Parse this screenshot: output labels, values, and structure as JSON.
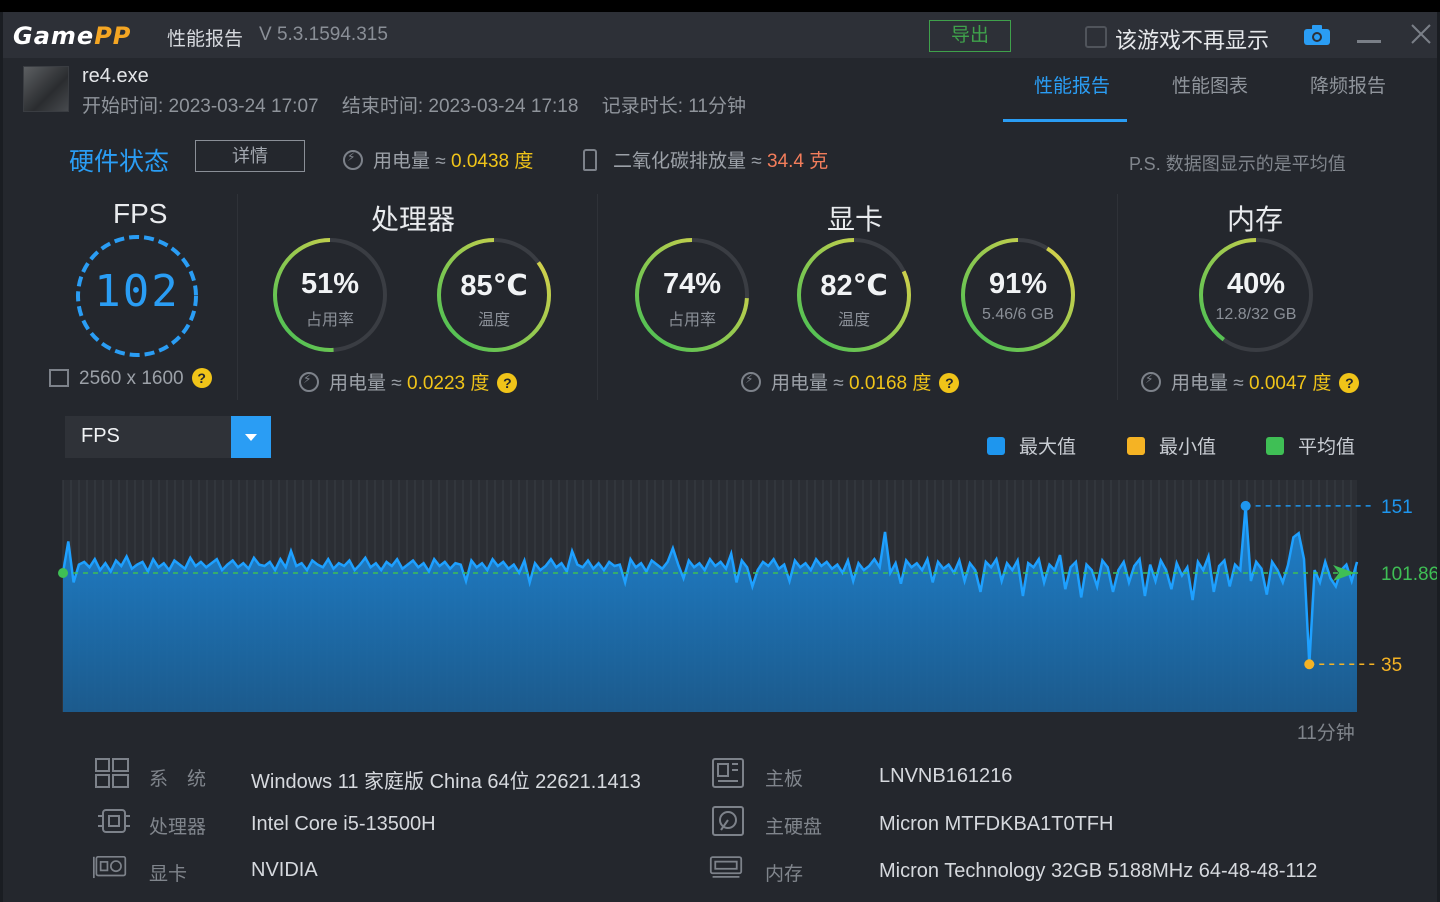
{
  "titlebar": {
    "logo_main": "Game",
    "logo_accent": "PP",
    "title": "性能报告",
    "version": "V 5.3.1594.315",
    "export_label": "导出",
    "hide_label": "该游戏不再显示",
    "icons": [
      "camera-icon",
      "minimize-icon",
      "close-icon"
    ]
  },
  "session": {
    "exe": "re4.exe",
    "start": "开始时间: 2023-03-24 17:07",
    "end": "结束时间: 2023-03-24 17:18",
    "duration": "记录时长: 11分钟"
  },
  "tabs": [
    {
      "label": "性能报告",
      "active": true
    },
    {
      "label": "性能图表",
      "active": false
    },
    {
      "label": "降频报告",
      "active": false
    }
  ],
  "hardware": {
    "title": "硬件状态",
    "detail_label": "详情",
    "power_label": "用电量 ≈ ",
    "power_value": "0.0438 度",
    "co2_label": "二氧化碳排放量 ≈ ",
    "co2_value": "34.4 克",
    "note": "P.S. 数据图显示的是平均值"
  },
  "sections": {
    "fps": {
      "head": "FPS",
      "value": "102",
      "resolution": "2560 x 1600"
    },
    "cpu": {
      "head": "处理器",
      "usage": "51%",
      "usage_label": "占用率",
      "usage_fraction": 0.51,
      "temp": "85℃",
      "temp_label": "温度",
      "temp_fraction": 0.85,
      "power_label": "用电量 ≈ ",
      "power_value": "0.0223 度"
    },
    "gpu": {
      "head": "显卡",
      "usage": "74%",
      "usage_label": "占用率",
      "usage_fraction": 0.74,
      "temp": "82℃",
      "temp_label": "温度",
      "temp_fraction": 0.82,
      "vram": "91%",
      "vram_label": "5.46/6 GB",
      "vram_fraction": 0.91,
      "power_label": "用电量 ≈ ",
      "power_value": "0.0168 度"
    },
    "memory": {
      "head": "内存",
      "usage": "40%",
      "usage_label": "12.8/32 GB",
      "usage_fraction": 0.4,
      "power_label": "用电量 ≈ ",
      "power_value": "0.0047 度"
    }
  },
  "metric_select": {
    "value": "FPS"
  },
  "legend": [
    {
      "label": "最大值",
      "color": "#1e96ee"
    },
    {
      "label": "最小值",
      "color": "#f5b324"
    },
    {
      "label": "平均值",
      "color": "#3fbf55"
    }
  ],
  "chart_data": {
    "type": "area",
    "title": "",
    "xlabel": "",
    "ylabel": "",
    "x_end_label": "11分钟",
    "ylim": [
      0,
      170
    ],
    "max": 151,
    "min": 35,
    "avg": 101.86,
    "max_label": "151",
    "min_label": "35",
    "avg_label": "101.86",
    "series": [
      {
        "values": [
          102,
          125,
          95,
          108,
          110,
          106,
          112,
          104,
          109,
          103,
          111,
          107,
          114,
          105,
          108,
          110,
          103,
          112,
          106,
          109,
          104,
          111,
          108,
          105,
          113,
          107,
          110,
          106,
          109,
          112,
          104,
          108,
          111,
          106,
          109,
          105,
          113,
          108,
          107,
          110,
          104,
          112,
          106,
          118,
          107,
          109,
          104,
          111,
          108,
          106,
          112,
          105,
          109,
          107,
          111,
          104,
          108,
          113,
          106,
          109,
          104,
          110,
          107,
          112,
          105,
          108,
          111,
          106,
          109,
          103,
          112,
          107,
          110,
          105,
          109,
          108,
          96,
          111,
          106,
          109,
          104,
          112,
          107,
          110,
          105,
          108,
          102,
          111,
          95,
          109,
          104,
          107,
          112,
          106,
          109,
          103,
          118,
          108,
          106,
          111,
          105,
          109,
          104,
          110,
          107,
          108,
          95,
          112,
          106,
          109,
          103,
          111,
          108,
          105,
          110,
          120,
          108,
          98,
          111,
          106,
          109,
          104,
          112,
          107,
          110,
          105,
          116,
          95,
          111,
          106,
          92,
          104,
          110,
          107,
          112,
          105,
          108,
          96,
          111,
          106,
          109,
          104,
          112,
          107,
          110,
          105,
          108,
          102,
          111,
          96,
          109,
          104,
          107,
          112,
          106,
          132,
          102,
          109,
          94,
          111,
          106,
          109,
          104,
          112,
          95,
          110,
          105,
          108,
          102,
          111,
          96,
          109,
          104,
          88,
          110,
          106,
          112,
          96,
          109,
          104,
          111,
          85,
          109,
          106,
          112,
          95,
          108,
          104,
          115,
          90,
          106,
          110,
          84,
          108,
          104,
          92,
          111,
          106,
          88,
          104,
          110,
          95,
          107,
          112,
          85,
          108,
          96,
          111,
          104,
          90,
          109,
          100,
          106,
          82,
          110,
          104,
          114,
          88,
          107,
          111,
          92,
          108,
          104,
          151,
          96,
          110,
          105,
          86,
          110,
          104,
          95,
          108,
          128,
          131,
          112,
          35,
          104,
          95,
          110,
          98,
          92,
          104,
          108,
          96,
          110
        ]
      }
    ]
  },
  "system_info": [
    {
      "key": "系　统",
      "value": "Windows 11 家庭版 China 64位 22621.1413",
      "icon": "windows-icon"
    },
    {
      "key": "处理器",
      "value": "Intel Core i5-13500H",
      "icon": "cpu-icon"
    },
    {
      "key": "显卡",
      "value": "NVIDIA",
      "icon": "gpu-icon"
    },
    {
      "key": "主板",
      "value": "LNVNB161216",
      "icon": "motherboard-icon"
    },
    {
      "key": "主硬盘",
      "value": "Micron MTFDKBA1T0TFH",
      "icon": "disk-icon"
    },
    {
      "key": "内存",
      "value": "Micron Technology 32GB 5188MHz 64-48-48-112",
      "icon": "memory-icon"
    }
  ]
}
